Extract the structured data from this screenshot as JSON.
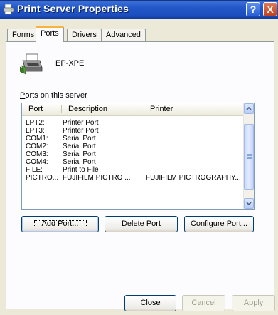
{
  "window": {
    "title": "Print Server Properties",
    "help_label": "?",
    "close_label": "X"
  },
  "tabs": [
    {
      "label": "Forms"
    },
    {
      "label": "Ports"
    },
    {
      "label": "Drivers"
    },
    {
      "label": "Advanced"
    }
  ],
  "server": {
    "name": "EP-XPE"
  },
  "ports_list": {
    "label_prefix": "P",
    "label_rest": "orts on this server",
    "columns": [
      "Port",
      "Description",
      "Printer"
    ],
    "rows": [
      {
        "port": "LPT2:",
        "description": "Printer Port",
        "printer": ""
      },
      {
        "port": "LPT3:",
        "description": "Printer Port",
        "printer": ""
      },
      {
        "port": "COM1:",
        "description": "Serial Port",
        "printer": ""
      },
      {
        "port": "COM2:",
        "description": "Serial Port",
        "printer": ""
      },
      {
        "port": "COM3:",
        "description": "Serial Port",
        "printer": ""
      },
      {
        "port": "COM4:",
        "description": "Serial Port",
        "printer": ""
      },
      {
        "port": "FILE:",
        "description": "Print to File",
        "printer": ""
      },
      {
        "port": "PICTRO...",
        "description": "FUJIFILM PICTRO ...",
        "printer": "FUJIFILM PICTROGRAPHY..."
      }
    ]
  },
  "actions": {
    "add_port": {
      "pre": "Add Po",
      "key": "r",
      "post": "t..."
    },
    "delete_port": {
      "key": "D",
      "post": "elete Port"
    },
    "configure_port": {
      "key": "C",
      "post": "onfigure Port..."
    }
  },
  "footer": {
    "close": "Close",
    "cancel": "Cancel",
    "apply_key": "A",
    "apply_rest": "pply"
  },
  "colors": {
    "titlebar": "#2358c9",
    "active_tab_accent": "#f8b43a",
    "dialog_bg": "#ece9d8"
  }
}
